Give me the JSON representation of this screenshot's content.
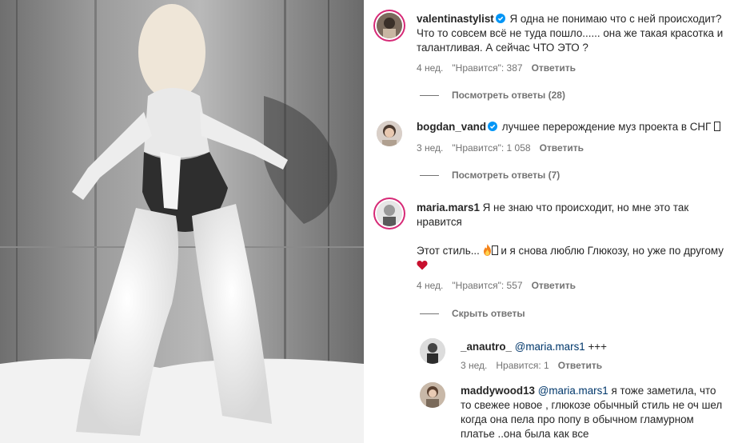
{
  "comments": [
    {
      "username": "valentinastylist",
      "verified": true,
      "text": "Я одна не понимаю что с ней происходит? Что то совсем всё не туда пошло...... она же такая красотка и талантливая. А сейчас ЧТО ЭТО ?",
      "age": "4 нед.",
      "likes": "\"Нравится\": 387",
      "reply_label": "Ответить",
      "toggle_label": "Посмотреть ответы (28)"
    },
    {
      "username": "bogdan_vand",
      "verified": true,
      "text": "лучшее перерождение муз проекта в СНГ ",
      "age": "3 нед.",
      "likes": "\"Нравится\": 1 058",
      "reply_label": "Ответить",
      "toggle_label": "Посмотреть ответы (7)"
    },
    {
      "username": "maria.mars1",
      "verified": false,
      "text": "Я не знаю что происходит, но мне это так нравится",
      "text2_a": "Этот стиль...",
      "text2_b": "и я снова люблю Глюкозу, но уже по другому",
      "age": "4 нед.",
      "likes": "\"Нравится\": 557",
      "reply_label": "Ответить",
      "toggle_label": "Скрыть ответы"
    }
  ],
  "replies": [
    {
      "username": "_anautro_",
      "mention": "@maria.mars1",
      "text": "+++",
      "age": "3 нед.",
      "likes": "Нравится: 1",
      "reply_label": "Ответить"
    },
    {
      "username": "maddywood13",
      "mention": "@maria.mars1",
      "text": "я тоже заметила, что то свежее новое , глюкозе обычный стиль не оч шел когда она пела про попу в обычном гламурном платье ..она была как все"
    }
  ],
  "colors": {
    "text": "#262626",
    "meta": "#737373",
    "verified": "#0095f6",
    "mention": "#00376b",
    "story_ring": "#d62976"
  },
  "icons": [
    "verified-badge-icon",
    "fire-emoji-icon",
    "heart-emoji-icon"
  ]
}
